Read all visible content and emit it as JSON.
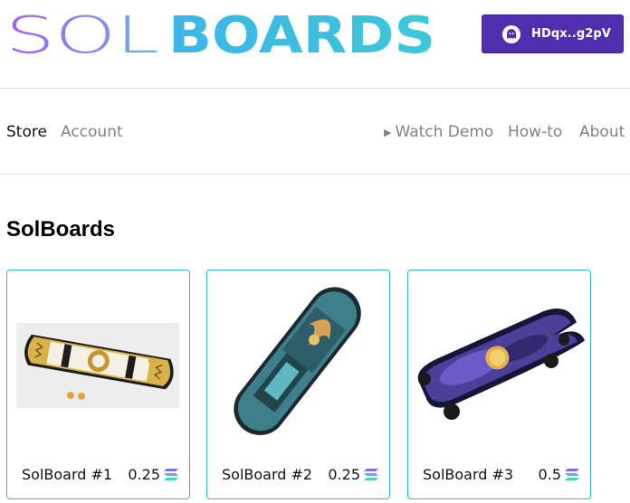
{
  "header": {
    "logo_left": "SOL",
    "logo_right": "BOARDS",
    "wallet_label": "HDqx..g2pV",
    "wallet_icon": "ghost-icon",
    "wallet_color": "#4f2fae"
  },
  "nav": {
    "store": "Store",
    "account": "Account",
    "watch_demo": "Watch Demo",
    "how_to": "How-to",
    "about": "About"
  },
  "main": {
    "title": "SolBoards",
    "accent_color": "#2cb7d4",
    "products": [
      {
        "name": "SolBoard #1",
        "price": "0.25",
        "currency_icon": "solana-icon"
      },
      {
        "name": "SolBoard #2",
        "price": "0.25",
        "currency_icon": "solana-icon"
      },
      {
        "name": "SolBoard #3",
        "price": "0.5",
        "currency_icon": "solana-icon"
      }
    ]
  }
}
